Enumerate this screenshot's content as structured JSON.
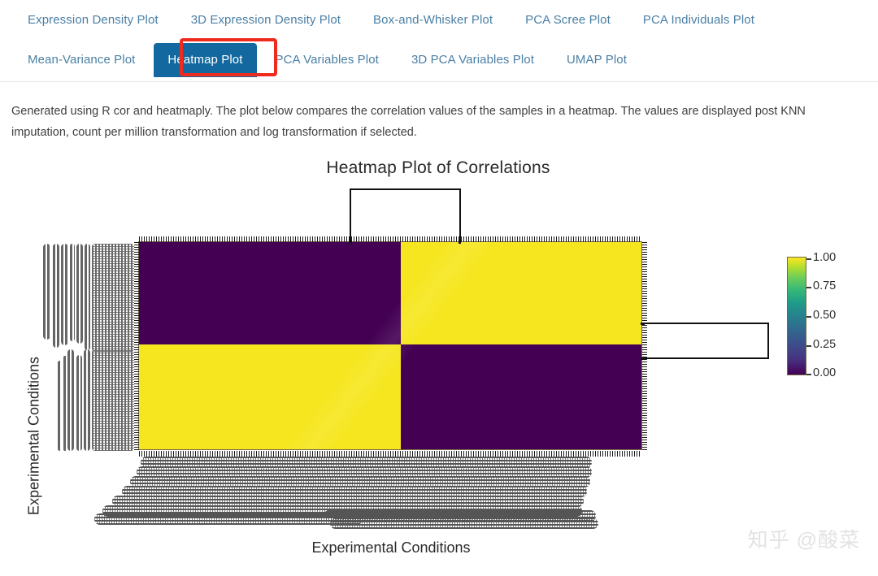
{
  "tabs": {
    "row1": [
      {
        "label": "Expression Density Plot",
        "active": false
      },
      {
        "label": "3D Expression Density Plot",
        "active": false
      },
      {
        "label": "Box-and-Whisker Plot",
        "active": false
      },
      {
        "label": "PCA Scree Plot",
        "active": false
      },
      {
        "label": "PCA Individuals Plot",
        "active": false
      }
    ],
    "row2": [
      {
        "label": "Mean-Variance Plot",
        "active": false
      },
      {
        "label": "Heatmap Plot",
        "active": true
      },
      {
        "label": "PCA Variables Plot",
        "active": false
      },
      {
        "label": "3D PCA Variables Plot",
        "active": false
      },
      {
        "label": "UMAP Plot",
        "active": false
      }
    ],
    "active_label": "Heatmap Plot",
    "link_color": "#4a7fa5",
    "active_bg_color": "#13699f",
    "highlight_color": "#ef2b1f"
  },
  "description": {
    "text": "Generated using R cor and heatmaply. The plot below compares the correlation values of the samples in a heatmap. The values are displayed post KNN imputation, count per million transformation and log transformation if selected."
  },
  "chart_data": {
    "type": "heatmap",
    "title": "Heatmap Plot of Correlations",
    "xlabel": "Experimental Conditions",
    "ylabel": "Experimental Conditions",
    "colormap": "viridis",
    "zlim": [
      0.0,
      1.0
    ],
    "colorbar_ticks": [
      "1.00",
      "0.75",
      "0.50",
      "0.25",
      "0.00"
    ],
    "colorbar_tick_values": [
      1.0,
      0.75,
      0.5,
      0.25,
      0.0
    ],
    "colorbar_low_color": "#440154",
    "colorbar_high_color": "#fde725",
    "block_structure": "2x2 checkerboard of two sample clusters",
    "row_clusters": [
      "cluster-1",
      "cluster-2"
    ],
    "col_clusters": [
      "cluster-1",
      "cluster-2"
    ],
    "blocks": [
      {
        "row": 0,
        "col": 0,
        "value": 0.0,
        "color": "#440154"
      },
      {
        "row": 0,
        "col": 1,
        "value": 1.0,
        "color": "#f6e61f"
      },
      {
        "row": 1,
        "col": 0,
        "value": 1.0,
        "color": "#f6e61f"
      },
      {
        "row": 1,
        "col": 1,
        "value": 0.0,
        "color": "#440154"
      }
    ],
    "dendrograms": {
      "top": true,
      "right": true,
      "left": false,
      "bottom": false
    },
    "grid": false,
    "legend_position": "right",
    "tick_labels_note": "Sample identifiers are overplotted into dense grey bands on both axes"
  },
  "watermark": {
    "text": "知乎 @酸菜"
  }
}
